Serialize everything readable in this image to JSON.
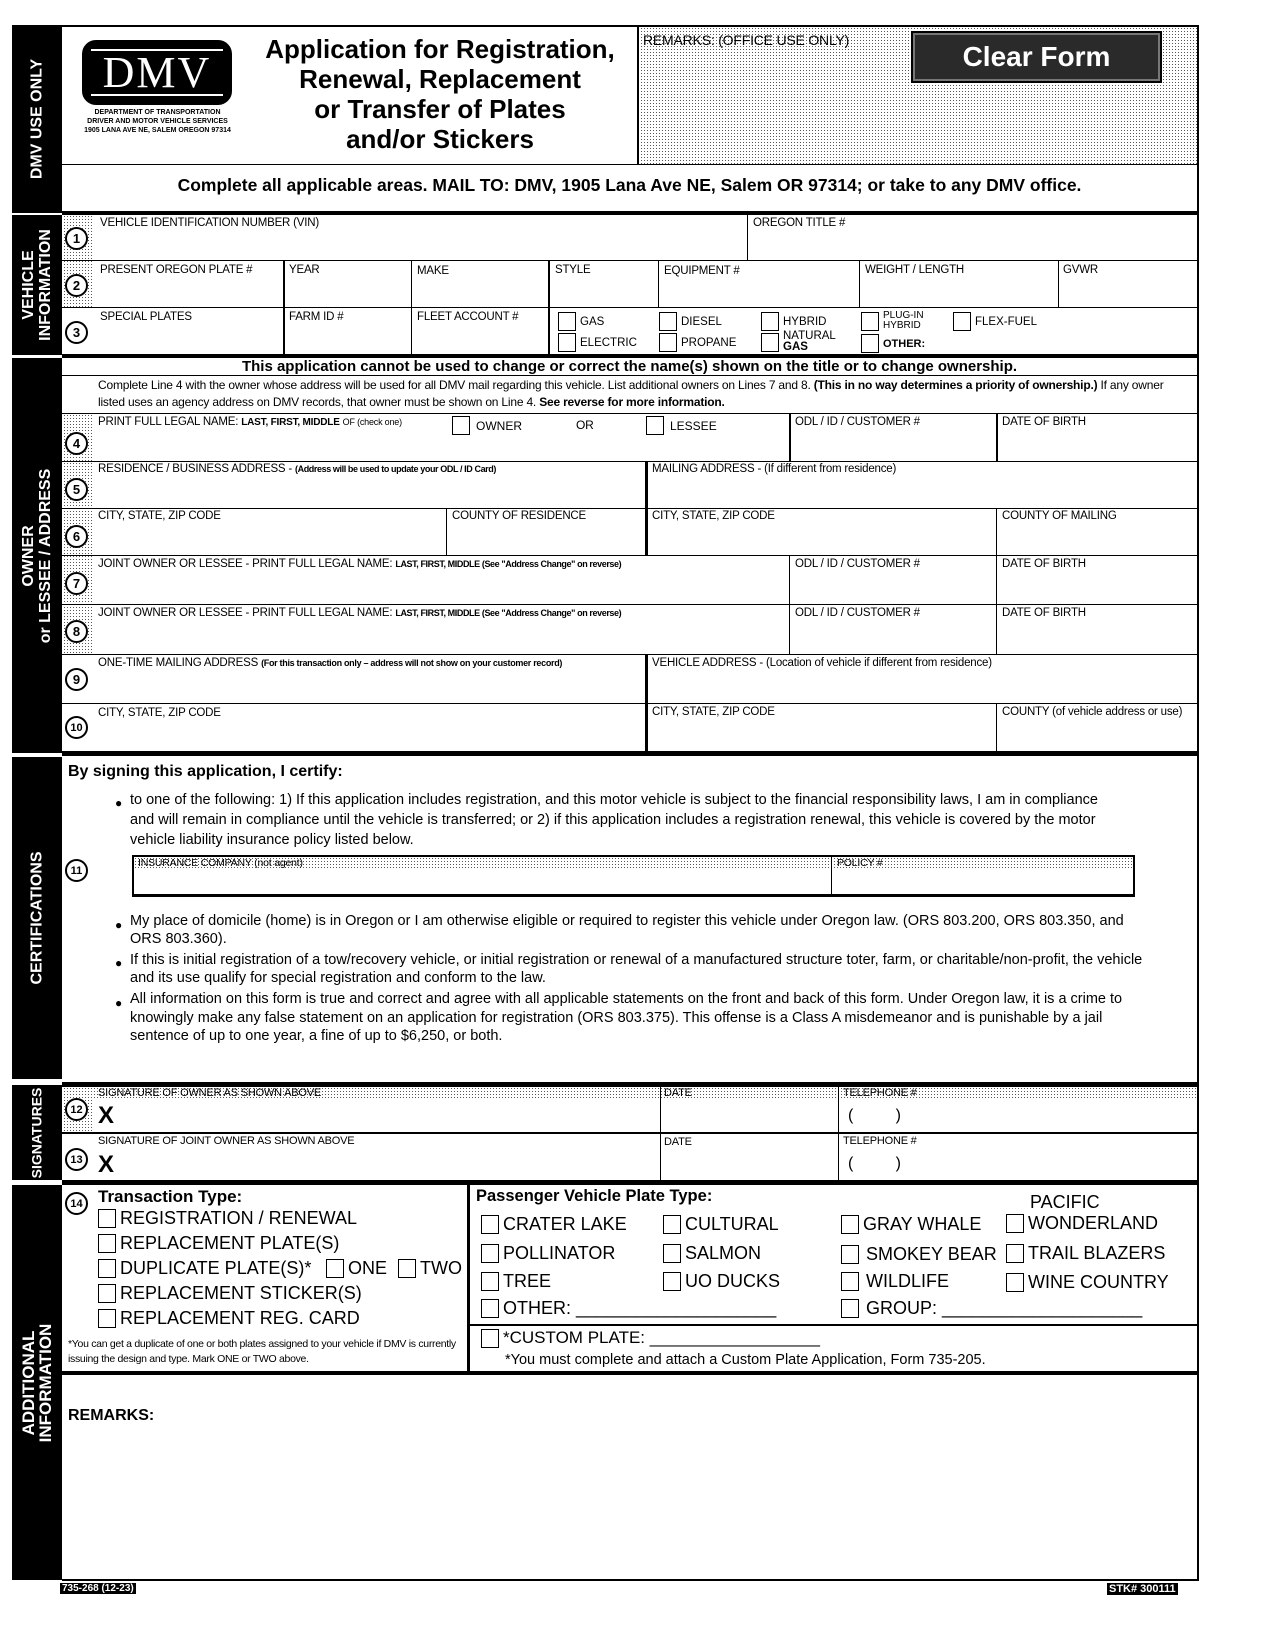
{
  "sidebar": {
    "dmv_use_only": "DMV USE ONLY",
    "vehicle_information": [
      "VEHICLE",
      "INFORMATION"
    ],
    "owner_lessee_address": [
      "OWNER",
      "or LESSEE / ADDRESS"
    ],
    "certifications": "CERTIFICATIONS",
    "signatures": "SIGNATURES",
    "additional_information": [
      "ADDITIONAL",
      "INFORMATION"
    ]
  },
  "header": {
    "logo_text": "DMV",
    "agency_lines": [
      "DEPARTMENT OF TRANSPORTATION",
      "DRIVER AND MOTOR VEHICLE SERVICES",
      "1905 LANA AVE NE, SALEM OREGON 97314"
    ],
    "title_lines": [
      "Application for Registration,",
      "Renewal, Replacement",
      "or Transfer of Plates",
      "and/or Stickers"
    ],
    "office_remarks_label": "REMARKS: (OFFICE USE ONLY)",
    "clear_form_button": "Clear Form",
    "instructions": "Complete all applicable areas. MAIL TO:  DMV, 1905 Lana Ave NE, Salem OR 97314; or take to any DMV office."
  },
  "vehicle": {
    "line1": {
      "num": "1",
      "vin": "VEHICLE IDENTIFICATION NUMBER (VIN)",
      "title": "OREGON TITLE #"
    },
    "line2": {
      "num": "2",
      "plate": "PRESENT OREGON PLATE #",
      "year": "YEAR",
      "make": "MAKE",
      "style": "STYLE",
      "equipment": "EQUIPMENT #",
      "weight": "WEIGHT / LENGTH",
      "gvwr": "GVWR"
    },
    "line3": {
      "num": "3",
      "special_plates": "SPECIAL PLATES",
      "farm_id": "FARM ID #",
      "fleet": "FLEET ACCOUNT #"
    },
    "fuel_types": {
      "gas": "GAS",
      "electric": "ELECTRIC",
      "diesel": "DIESEL",
      "propane": "PROPANE",
      "hybrid": "HYBRID",
      "natural_gas_1": "NATURAL",
      "natural_gas_2": "GAS",
      "plugin_1": "PLUG-IN",
      "plugin_2": "HYBRID",
      "other": "OTHER:",
      "flex": "FLEX-FUEL"
    }
  },
  "owner": {
    "warning": "This application cannot be used to change or correct the name(s) shown on the title or to change ownership.",
    "instr_1": "Complete Line 4 with the owner whose address will be used for all DMV mail regarding this vehicle.  List additional owners on Lines 7 and 8. ",
    "instr_1_bold": "(This in no way determines a priority of ownership.)",
    "instr_2": " If any owner listed uses an agency address on DMV records, that owner must be shown on Line 4. ",
    "instr_2_bold": "See reverse for more information.",
    "line4": {
      "num": "4",
      "name": "PRINT FULL LEGAL NAME:",
      "name_bold": "LAST, FIRST, MIDDLE",
      "check_one": "OF (check one)",
      "owner": "OWNER",
      "or": "OR",
      "lessee": "LESSEE",
      "odl": "ODL / ID / CUSTOMER #",
      "dob": "DATE OF BIRTH"
    },
    "line5": {
      "num": "5",
      "residence": "RESIDENCE / BUSINESS ADDRESS - ",
      "residence_bold": "(Address will be used to update your ODL /  ID Card)",
      "mailing": "MAILING ADDRESS - (If different from residence)"
    },
    "line6": {
      "num": "6",
      "city": "CITY, STATE, ZIP CODE",
      "county_res": "COUNTY OF RESIDENCE",
      "city2": "CITY, STATE, ZIP CODE",
      "county_mail": "COUNTY OF MAILING"
    },
    "line7": {
      "num": "7",
      "name": "JOINT OWNER OR LESSEE - PRINT FULL LEGAL NAME:",
      "name_bold": "LAST, FIRST, MIDDLE (See \"Address Change\" on reverse)",
      "odl": "ODL / ID / CUSTOMER #",
      "dob": "DATE OF BIRTH"
    },
    "line8": {
      "num": "8",
      "name": "JOINT OWNER OR LESSEE - PRINT FULL LEGAL NAME:",
      "name_bold": "LAST, FIRST, MIDDLE (See \"Address Change\" on reverse)",
      "odl": "ODL / ID / CUSTOMER #",
      "dob": "DATE OF BIRTH"
    },
    "line9": {
      "num": "9",
      "onetime": "ONE-TIME MAILING ADDRESS ",
      "onetime_bold": "(For this transaction only – address will not show on your customer record)",
      "vehicle_addr": "VEHICLE ADDRESS - (Location of vehicle if different from residence)"
    },
    "line10": {
      "num": "10",
      "city": "CITY, STATE, ZIP CODE",
      "city2": "CITY, STATE, ZIP CODE",
      "county": "COUNTY (of vehicle address or use)"
    }
  },
  "certifications": {
    "heading": "By signing this application, I certify:",
    "bullet1": "to one of the following: 1) If this application includes registration, and this motor vehicle is subject to the financial responsibility laws, I am in compliance and will remain in compliance until the vehicle is transferred; or 2) if this application includes a registration renewal, this vehicle is covered by the motor vehicle liability insurance policy listed below.",
    "line11_num": "11",
    "insurance_company": "INSURANCE COMPANY (not agent)",
    "policy": "POLICY #",
    "bullet2": "My place of domicile (home) is in Oregon or I am otherwise eligible or required to register this vehicle under Oregon law. (ORS 803.200, ORS 803.350, and ORS 803.360).",
    "bullet3": "If this is initial registration of a tow/recovery vehicle, or initial registration or renewal of a manufactured structure toter, farm, or charitable/non-profit, the vehicle and its use qualify for special registration and conform to the law.",
    "bullet4": "All information on this form is true and correct and agree with all applicable statements on the front and back of this form. Under Oregon law, it is a crime to knowingly make any false statement on an application for registration (ORS 803.375). This offense is a Class A misdemeanor and is punishable by a jail sentence of up to one year, a fine of up to $6,250, or both."
  },
  "signatures": {
    "line12": {
      "num": "12",
      "label": "SIGNATURE OF OWNER AS SHOWN ABOVE",
      "x": "X",
      "date": "DATE",
      "phone": "TELEPHONE #",
      "paren": "(          )"
    },
    "line13": {
      "num": "13",
      "label": "SIGNATURE OF JOINT OWNER AS SHOWN ABOVE",
      "x": "X",
      "date": "DATE",
      "phone": "TELEPHONE #",
      "paren": "(          )"
    }
  },
  "additional": {
    "line14_num": "14",
    "transaction_heading": "Transaction Type:",
    "transaction_types": [
      "REGISTRATION / RENEWAL",
      "REPLACEMENT PLATE(S)",
      "DUPLICATE PLATE(S)*",
      "REPLACEMENT STICKER(S)",
      "REPLACEMENT REG. CARD"
    ],
    "dup_one": "ONE",
    "dup_two": "TWO",
    "dup_note": "*You can get a duplicate of one or both plates assigned to your vehicle if DMV is currently issuing the design and type. Mark ONE or TWO above.",
    "plate_heading": "Passenger Vehicle Plate Type:",
    "plates": {
      "col1": [
        "CRATER LAKE",
        "POLLINATOR",
        "TREE"
      ],
      "col2": [
        "CULTURAL",
        "SALMON",
        "UO DUCKS"
      ],
      "col3": [
        "GRAY WHALE",
        "SMOKEY BEAR",
        "WILDLIFE"
      ],
      "col4_top": "PACIFIC",
      "col4": [
        "WONDERLAND",
        "TRAIL BLAZERS",
        "WINE COUNTRY"
      ],
      "other": "OTHER: ____________________",
      "group": "GROUP: ____________________"
    },
    "custom_plate": "*CUSTOM PLATE: __________________",
    "custom_note": "*You must complete and attach a Custom Plate Application, Form 735-205.",
    "remarks": "REMARKS:"
  },
  "footer": {
    "form_number": "735-268 (12-23)",
    "stock_number": "STK# 300111"
  }
}
